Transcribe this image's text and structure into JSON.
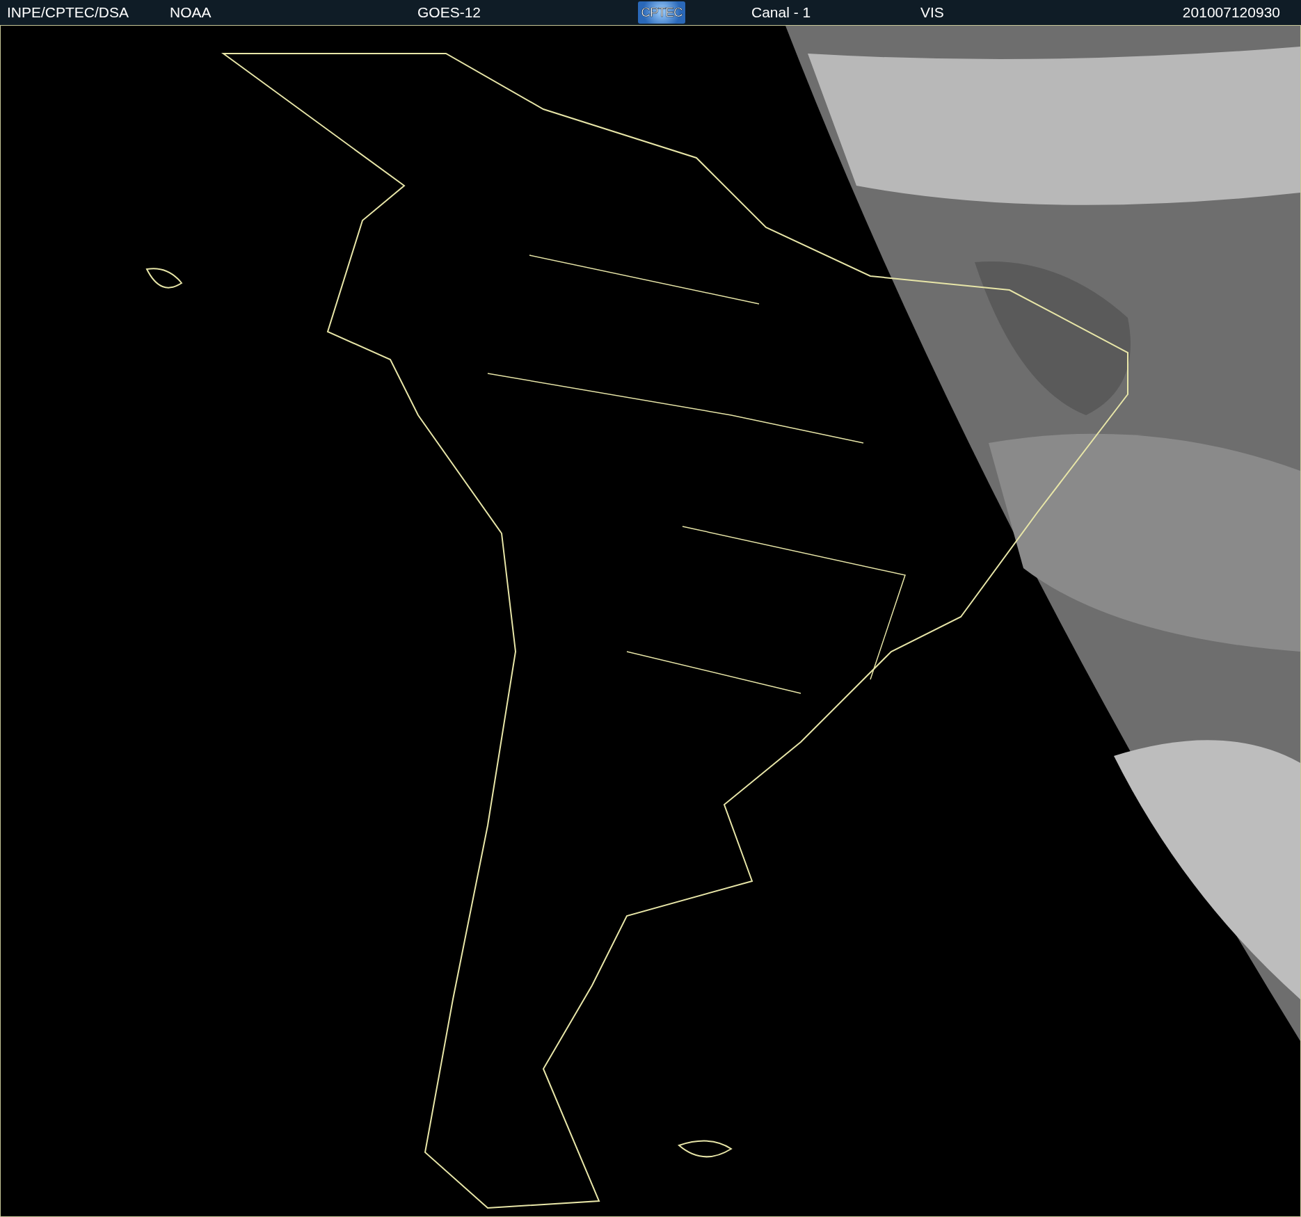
{
  "header": {
    "items": [
      {
        "kind": "text",
        "text": "INPE/CPTEC/DSA"
      },
      {
        "kind": "text",
        "text": "NOAA"
      },
      {
        "kind": "text",
        "text": "GOES-12"
      },
      {
        "kind": "logo",
        "text": "CPTEC"
      },
      {
        "kind": "text",
        "text": "Canal - 1"
      },
      {
        "kind": "text",
        "text": "VIS"
      },
      {
        "kind": "text",
        "text": "201007120930"
      }
    ]
  }
}
